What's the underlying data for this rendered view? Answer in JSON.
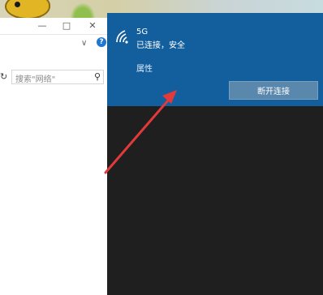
{
  "explorer": {
    "minimize_glyph": "—",
    "maximize_glyph": "□",
    "close_glyph": "✕",
    "chevron_glyph": "∨",
    "help_glyph": "?",
    "refresh_glyph": "↻",
    "search_placeholder": "搜索\"网络\"",
    "search_glyph": "⚲"
  },
  "network": {
    "ssid": "5G",
    "status": "已连接，安全",
    "properties_label": "属性",
    "disconnect_label": "断开连接",
    "icon": "wifi-icon"
  },
  "annotation": {
    "arrow_color": "#e23a3a"
  }
}
